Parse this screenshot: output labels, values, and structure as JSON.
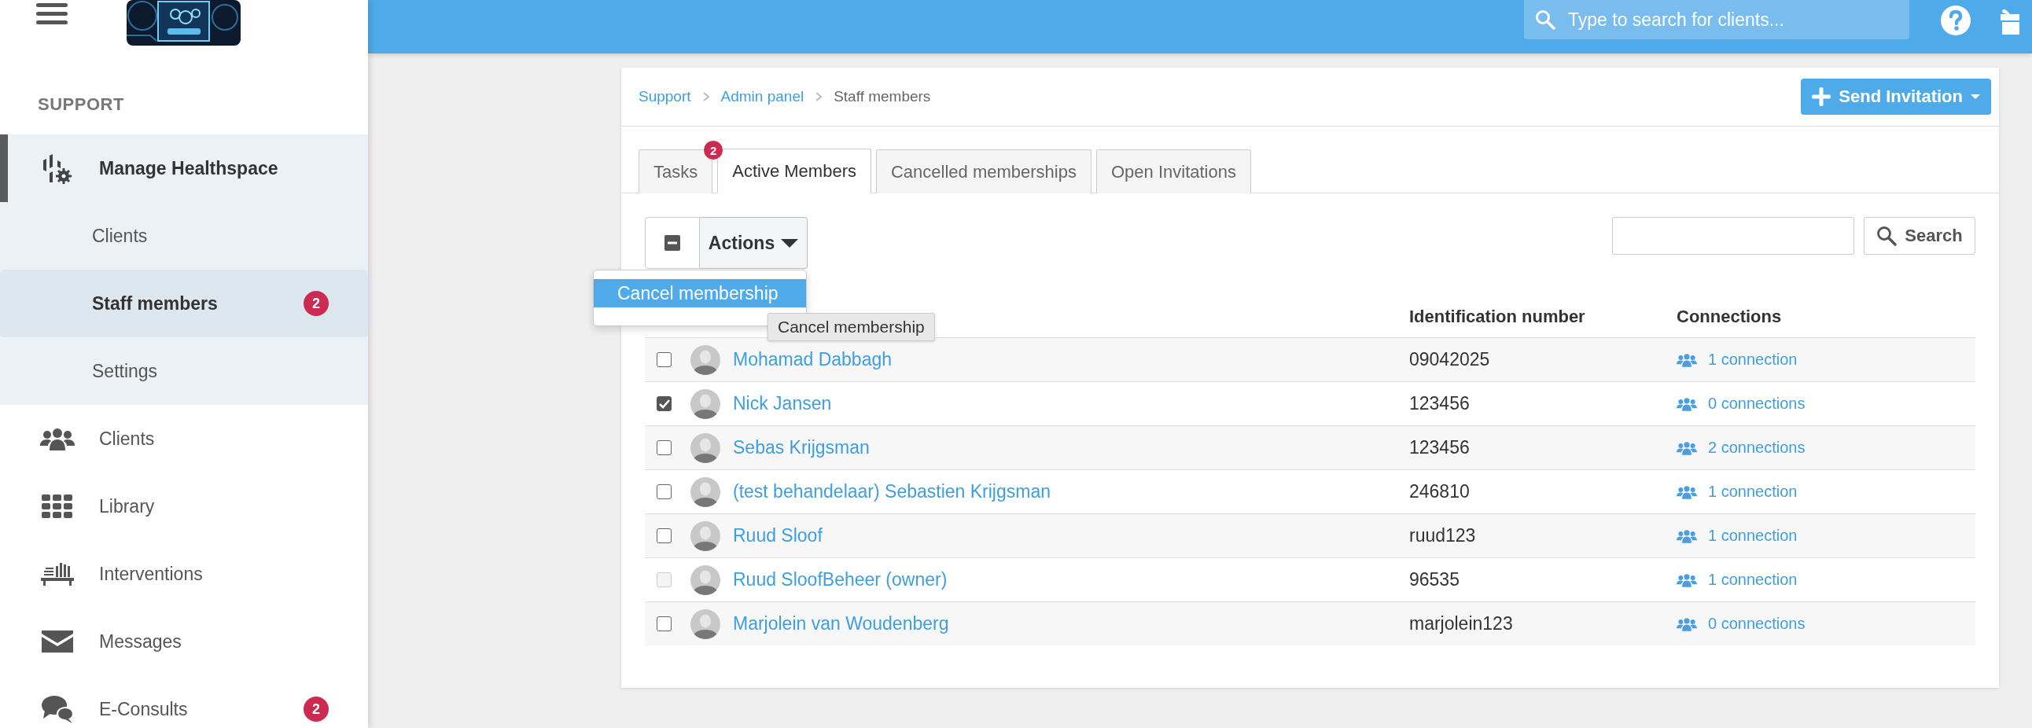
{
  "app_bar": {
    "search": {
      "placeholder": "Type to search for clients..."
    }
  },
  "sidebar": {
    "section": "SUPPORT",
    "items": [
      {
        "label": "Manage Healthspace",
        "selected": true,
        "children": [
          {
            "label": "Clients",
            "selected": false
          },
          {
            "label": "Staff members",
            "selected": true,
            "badge": "2"
          },
          {
            "label": "Settings",
            "selected": false
          }
        ]
      },
      {
        "label": "Clients",
        "selected": false
      },
      {
        "label": "Library",
        "selected": false
      },
      {
        "label": "Interventions",
        "selected": false
      },
      {
        "label": "Messages",
        "selected": false
      },
      {
        "label": "E-Consults",
        "selected": false,
        "badge": "2"
      }
    ]
  },
  "breadcrumb": [
    "Support",
    "Admin panel",
    "Staff members"
  ],
  "send_button": "Send Invitation",
  "tabs": [
    {
      "label": "Tasks",
      "selected": false,
      "badge": "2"
    },
    {
      "label": "Active Members",
      "selected": true
    },
    {
      "label": "Cancelled memberships",
      "selected": false
    },
    {
      "label": "Open Invitations",
      "selected": false
    }
  ],
  "actions_button": "Actions",
  "actions_menu": [
    {
      "label": "Cancel membership",
      "selected": true
    }
  ],
  "tooltip": "Cancel membership",
  "search_button": "Search",
  "table": {
    "columns": [
      "Identification number",
      "Connections"
    ],
    "rows": [
      {
        "name": "Mohamad Dabbagh",
        "id": "09042025",
        "connections": "1 connection",
        "checked": false,
        "disabled": false
      },
      {
        "name": "Nick Jansen",
        "id": "123456",
        "connections": "0 connections",
        "checked": true,
        "disabled": false
      },
      {
        "name": "Sebas Krijgsman",
        "id": "123456",
        "connections": "2 connections",
        "checked": false,
        "disabled": false
      },
      {
        "name": "(test behandelaar) Sebastien Krijgsman",
        "id": "246810",
        "connections": "1 connection",
        "checked": false,
        "disabled": false
      },
      {
        "name": "Ruud Sloof",
        "id": "ruud123",
        "connections": "1 connection",
        "checked": false,
        "disabled": false
      },
      {
        "name": "Ruud SloofBeheer (owner)",
        "id": "96535",
        "connections": "1 connection",
        "checked": false,
        "disabled": true
      },
      {
        "name": "Marjolein van Woudenberg",
        "id": "marjolein123",
        "connections": "0 connections",
        "checked": false,
        "disabled": false
      }
    ]
  }
}
